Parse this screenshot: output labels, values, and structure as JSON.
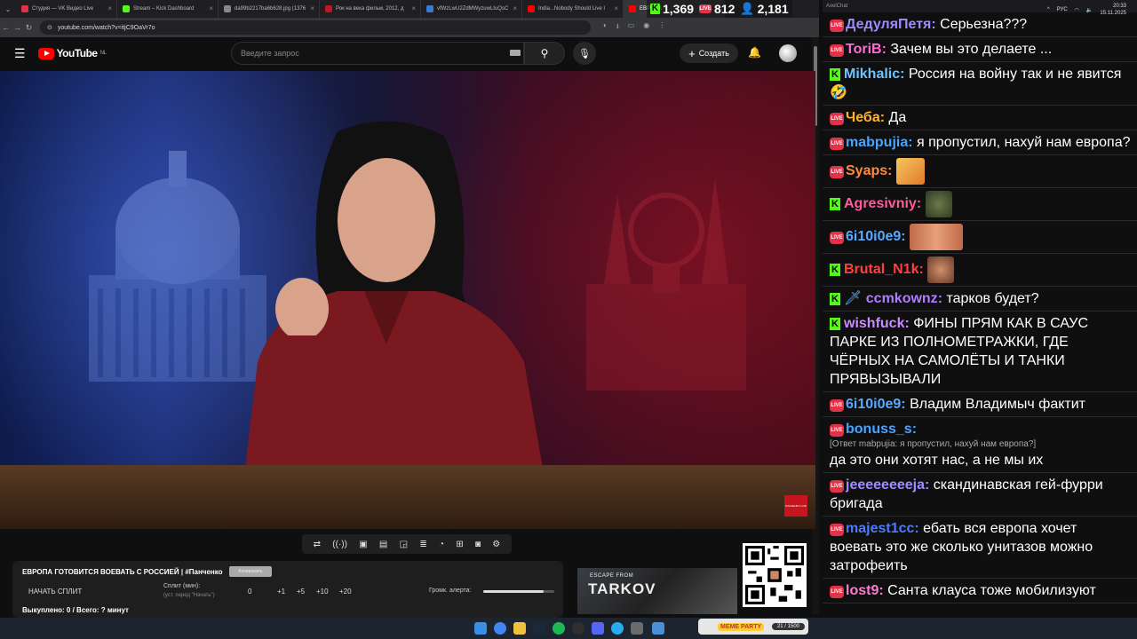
{
  "browser": {
    "tabs": [
      {
        "title": "Студия — VK Видео Live",
        "color": "#e0334a"
      },
      {
        "title": "Stream – Kick Dashboard",
        "color": "#53fc18"
      },
      {
        "title": "da99b2217ba6b628.jpg (1376",
        "color": "#888888"
      },
      {
        "title": "Рок на века фильм, 2012, д",
        "color": "#c4161c"
      },
      {
        "title": "vfWzLwU2ZdMWyzuwLIuQsC",
        "color": "#3a7bd5"
      },
      {
        "title": "India...Nobody Should Live I",
        "color": "#ff0000"
      },
      {
        "title": "ЕВРОПА",
        "color": "#ff0000",
        "active": true
      }
    ],
    "url": "youtube.com/watch?v=itjC9OaVr7o"
  },
  "stream_stats": {
    "kick_viewers": "1,369",
    "vk_viewers": "812",
    "total_viewers": "2,181",
    "vk_badge": "LIVE"
  },
  "youtube": {
    "logo_text": "YouTube",
    "region": "NL",
    "search_placeholder": "Введите запрос",
    "create_label": "Создать"
  },
  "video": {
    "title": "ЕВРОПА ГОТОВИТСЯ ВОЕВАТЬ С РОССИЕЙ | #Панченко",
    "copy_button": "Копировать",
    "channel_badge": "ПАНЧЕНКО LIVE"
  },
  "split_panel": {
    "start_label": "НАЧАТЬ СПЛИТ",
    "split_label": "Сплит (мин):",
    "split_hint": "(уст. перед \"Начать\")",
    "split_value": "0",
    "increments": [
      "+1",
      "+5",
      "+10",
      "+20"
    ],
    "alert_volume_label": "Громк. алерта:",
    "alert_volume": 0.85,
    "sold_label": "Выкуплено: 0 / Всего: ? минут"
  },
  "promo": {
    "tarkov_top": "ESCAPE FROM",
    "tarkov_logo": "TARKOV"
  },
  "taskbar": {
    "meme_party_label": "MEME PARTY",
    "meme_party_count": "21 / 1500",
    "lang": "РУС",
    "time": "20:33",
    "date": "15.11.2025"
  },
  "chat": {
    "window_title": "AxelChat",
    "messages": [
      {
        "platform": "vk",
        "user": "ДедуляПетя",
        "color": "#9b8cff",
        "text": "Серьезна???"
      },
      {
        "platform": "vk",
        "user": "ToriB",
        "color": "#ff6bd5",
        "text": "Зачем вы это делаете ..."
      },
      {
        "platform": "kick",
        "user": "Mikhalic",
        "color": "#6ec3ff",
        "text": "Россия на войну так и не явится 🤣"
      },
      {
        "platform": "vk",
        "user": "Чеба",
        "color": "#ffb52e",
        "text": "Да"
      },
      {
        "platform": "vk",
        "user": "mabpujia",
        "color": "#4aa3ff",
        "text": "я пропустил, нахуй нам европа?"
      },
      {
        "platform": "vk",
        "user": "Syaps",
        "color": "#ff8a3d",
        "text": "",
        "emote": "hands"
      },
      {
        "platform": "kick",
        "user": "Agresivniy",
        "color": "#ff5c9a",
        "text": "",
        "emote": "frog"
      },
      {
        "platform": "vk",
        "user": "6i10i0e9",
        "color": "#5aa8ff",
        "text": "",
        "emote": "face-wide"
      },
      {
        "platform": "kick",
        "user": "Brutal_N1k",
        "color": "#ff4040",
        "text": "",
        "emote": "face"
      },
      {
        "platform": "kick",
        "user": "ccmkownz",
        "color": "#b07cff",
        "text": "тарков будет?",
        "sword": true
      },
      {
        "platform": "kick",
        "user": "wishfuck",
        "color": "#c98bff",
        "text": "ФИНЫ ПРЯМ КАК В САУС ПАРКЕ ИЗ ПОЛНОМЕТРАЖКИ, ГДЕ ЧЁРНЫХ НА САМОЛЁТЫ И ТАНКИ ПРЯВЫЗЫВАЛИ"
      },
      {
        "platform": "vk",
        "user": "6i10i0e9",
        "color": "#5aa8ff",
        "text": "Владим Владимыч фактит"
      },
      {
        "platform": "vk",
        "user": "bonuss_s",
        "color": "#4aa3ff",
        "text": "",
        "reply": "[Ответ mabpujia: я пропустил, нахуй нам европа?]",
        "reply_text": "да это они хотят нас, а не мы их"
      },
      {
        "platform": "vk",
        "user": "jeeeeeeeeja",
        "color": "#a08cff",
        "text": "скандинавская гей-фурри бригада"
      },
      {
        "platform": "vk",
        "user": "majest1cc",
        "color": "#4a7bff",
        "text": "ебать вся европа хочет воевать это же сколько унитазов можно затрофеить"
      },
      {
        "platform": "vk",
        "user": "lost9",
        "color": "#ff7ad1",
        "text": "Санта клауса тоже мобилизуют"
      }
    ]
  }
}
